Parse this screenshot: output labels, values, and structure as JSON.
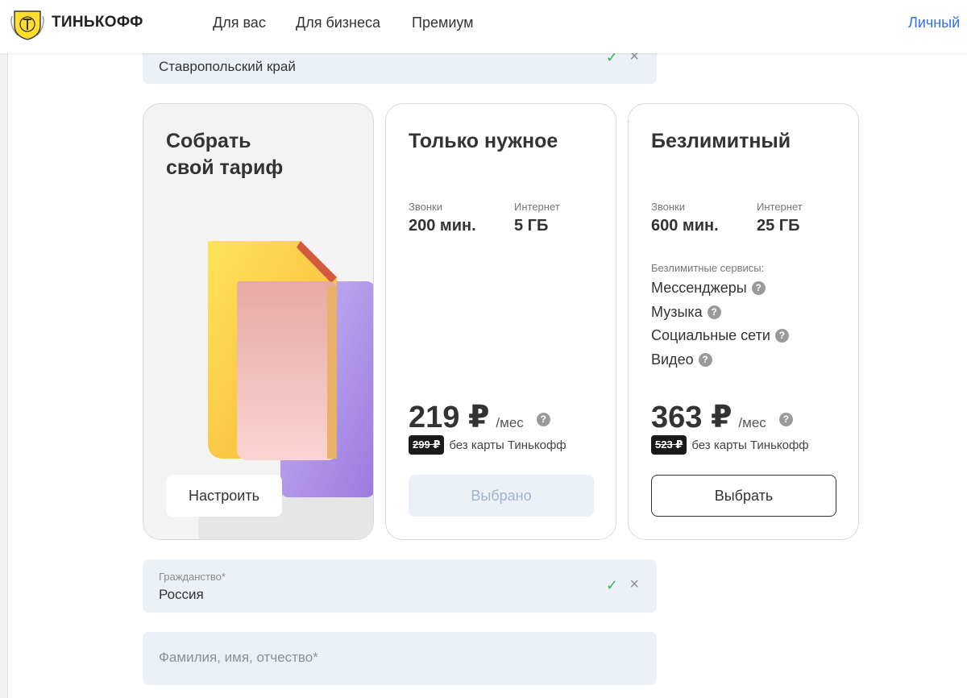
{
  "header": {
    "brand": "ТИНЬКОФФ",
    "nav": [
      "Для вас",
      "Для бизнеса",
      "Премиум"
    ],
    "right_link": "Личный"
  },
  "region_field": {
    "value": "Ставропольский край"
  },
  "cards": {
    "custom": {
      "title_line1": "Собрать",
      "title_line2": "свой тариф",
      "button": "Настроить"
    },
    "only_needed": {
      "title": "Только нужное",
      "calls_label": "Звонки",
      "calls_value": "200 мин.",
      "internet_label": "Интернет",
      "internet_value": "5 ГБ",
      "price": "219 ₽",
      "per": "/мес",
      "old_price": "299 ₽",
      "old_note": "без карты Тинькофф",
      "button": "Выбрано"
    },
    "unlimited": {
      "title": "Безлимитный",
      "calls_label": "Звонки",
      "calls_value": "600 мин.",
      "internet_label": "Интернет",
      "internet_value": "25 ГБ",
      "services_caption": "Безлимитные сервисы:",
      "services": [
        "Мессенджеры",
        "Музыка",
        "Социальные сети",
        "Видео"
      ],
      "price": "363 ₽",
      "per": "/мес",
      "old_price": "523 ₽",
      "old_note": "без карты Тинькофф",
      "button": "Выбрать"
    }
  },
  "citizenship_field": {
    "label": "Гражданство*",
    "value": "Россия"
  },
  "name_field": {
    "placeholder": "Фамилия, имя, отчество*"
  },
  "colors": {
    "accent_link": "#336fee",
    "field_bg": "#ecf1f7",
    "check": "#2db653"
  }
}
